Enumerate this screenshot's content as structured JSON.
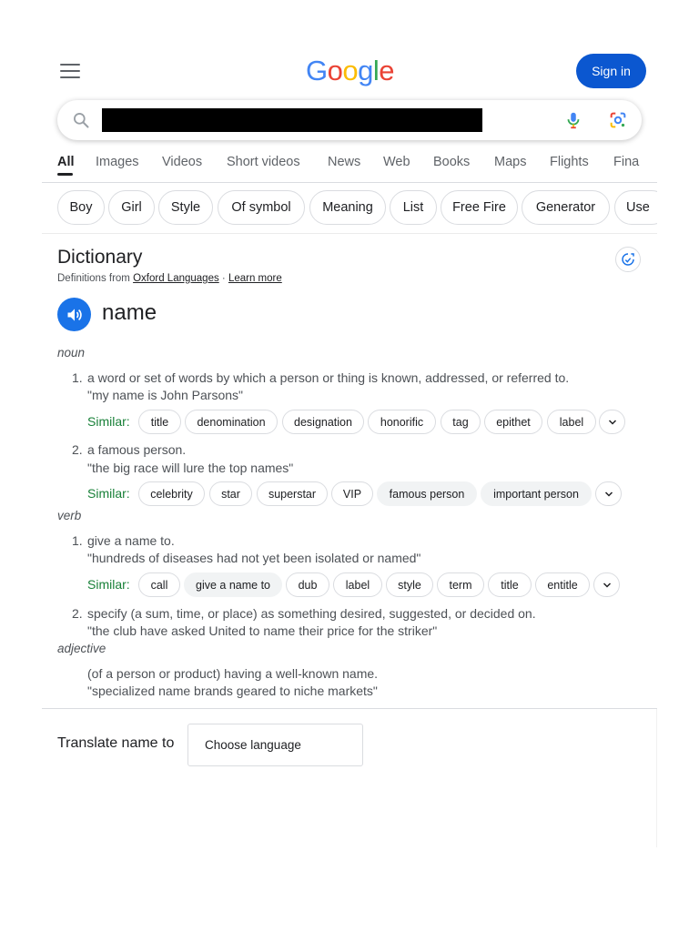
{
  "header": {
    "logo": {
      "l1": "G",
      "l2": "o",
      "l3": "o",
      "l4": "g",
      "l5": "l",
      "l6": "e"
    },
    "signin_label": "Sign in"
  },
  "search": {
    "query": "",
    "placeholder": ""
  },
  "tabs": [
    {
      "label": "All"
    },
    {
      "label": "Images"
    },
    {
      "label": "Videos"
    },
    {
      "label": "Short videos"
    },
    {
      "label": "News"
    },
    {
      "label": "Web"
    },
    {
      "label": "Books"
    },
    {
      "label": "Maps"
    },
    {
      "label": "Flights"
    },
    {
      "label": "Fina"
    }
  ],
  "chips": [
    {
      "label": "Boy"
    },
    {
      "label": "Girl"
    },
    {
      "label": "Style"
    },
    {
      "label": "Of symbol"
    },
    {
      "label": "Meaning"
    },
    {
      "label": "List"
    },
    {
      "label": "Free Fire"
    },
    {
      "label": "Generator"
    },
    {
      "label": "Use"
    }
  ],
  "dictionary": {
    "title": "Dictionary",
    "source_prefix": "Definitions from ",
    "source_link": "Oxford Languages",
    "separator": " · ",
    "learn_more": "Learn more",
    "headword": "name",
    "similar_label": "Similar:",
    "noun": {
      "pos": "noun",
      "defs": [
        {
          "num": "1.",
          "text": "a word or set of words by which a person or thing is known, addressed, or referred to.",
          "example": "\"my name is John Parsons\"",
          "similar": [
            "title",
            "denomination",
            "designation",
            "honorific",
            "tag",
            "epithet",
            "label"
          ]
        },
        {
          "num": "2.",
          "text": "a famous person.",
          "example": "\"the big race will lure the top names\"",
          "similar": [
            "celebrity",
            "star",
            "superstar",
            "VIP",
            "famous person",
            "important person"
          ]
        }
      ]
    },
    "verb": {
      "pos": "verb",
      "defs": [
        {
          "num": "1.",
          "text": "give a name to.",
          "example": "\"hundreds of diseases had not yet been isolated or named\"",
          "similar": [
            "call",
            "give a name to",
            "dub",
            "label",
            "style",
            "term",
            "title",
            "entitle"
          ]
        },
        {
          "num": "2.",
          "text": "specify (a sum, time, or place) as something desired, suggested, or decided on.",
          "example": "\"the club have asked United to name their price for the striker\""
        }
      ]
    },
    "adjective": {
      "pos": "adjective",
      "text": "(of a person or product) having a well-known name.",
      "example": "\"specialized name brands geared to niche markets\""
    }
  },
  "translate": {
    "label": "Translate name to",
    "select_value": "Choose language"
  },
  "colors": {
    "accent": "#0b57d0",
    "similar_green": "#188038",
    "speaker_blue": "#1a73e8"
  }
}
